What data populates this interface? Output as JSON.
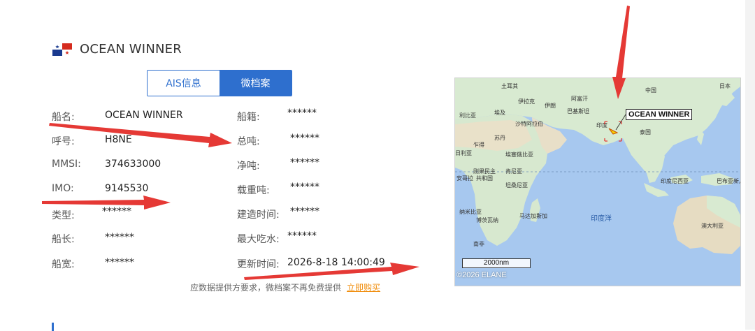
{
  "header": {
    "ship_name": "OCEAN WINNER",
    "flag_icon": "panama-flag-icon"
  },
  "tabs": [
    {
      "label": "AIS信息",
      "active": false
    },
    {
      "label": "微档案",
      "active": true
    }
  ],
  "left_fields": [
    {
      "label": "船名:",
      "value": "OCEAN WINNER"
    },
    {
      "label": "呼号:",
      "value": "H8NE"
    },
    {
      "label": "MMSI:",
      "value": "374633000"
    },
    {
      "label": "IMO:",
      "value": "9145530"
    },
    {
      "label": "类型:",
      "value": "******"
    },
    {
      "label": "船长:",
      "value": "******"
    },
    {
      "label": "船宽:",
      "value": "******"
    }
  ],
  "right_fields": [
    {
      "label": "船籍:",
      "value": "******"
    },
    {
      "label": "总吨:",
      "value": "******"
    },
    {
      "label": "净吨:",
      "value": "******"
    },
    {
      "label": "载重吨:",
      "value": "******"
    },
    {
      "label": "建造时间:",
      "value": "******"
    },
    {
      "label": "最大吃水:",
      "value": "******"
    },
    {
      "label": "更新时间:",
      "value": "2026-8-18 14:00:49"
    }
  ],
  "notice": {
    "text": "应数据提供方要求，微档案不再免费提供",
    "link": "立即购买"
  },
  "map": {
    "ship_label": "OCEAN WINNER",
    "scale": "2000nm",
    "copyright": "©2026 ELANE",
    "ocean_label": "印度洋",
    "labels": [
      "土耳其",
      "中国",
      "日本",
      "伊拉克",
      "阿富汗",
      "利比亚",
      "埃及",
      "伊朗",
      "巴基斯坦",
      "沙特阿拉伯",
      "印度",
      "泰国",
      "苏丹",
      "乍得",
      "埃塞俄比亚",
      "刚果民主共和国",
      "肯尼亚",
      "坦桑尼亚",
      "安哥拉",
      "纳米比亚",
      "博茨瓦纳",
      "马达加斯加",
      "南非",
      "印度尼西亚",
      "巴布亚新几内亚",
      "澳大利亚",
      "尼日利亚"
    ]
  },
  "colors": {
    "accent": "#2e6fce",
    "link": "#f08c0a",
    "annotation_arrow": "#e53935"
  }
}
